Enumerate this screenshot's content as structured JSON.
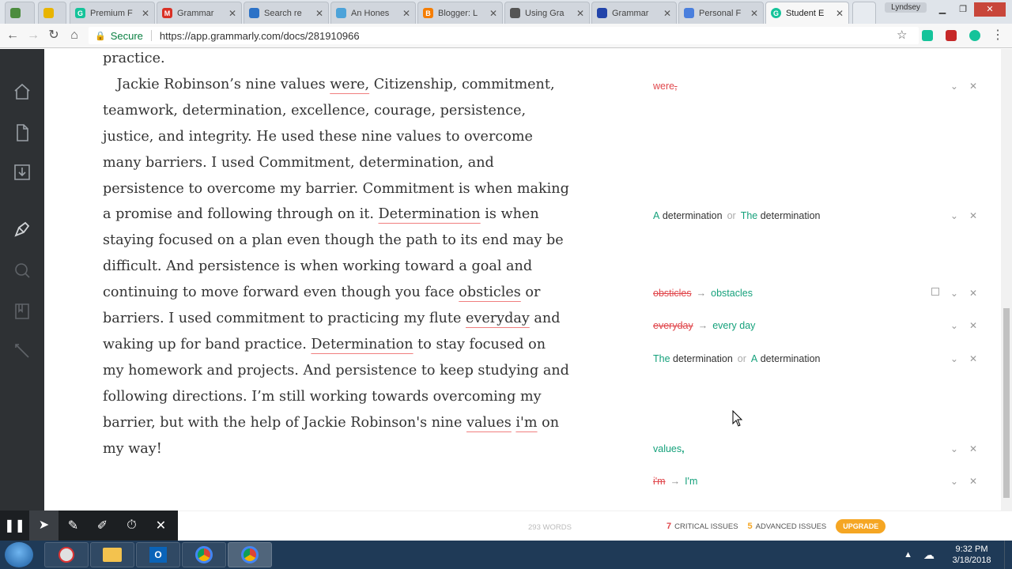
{
  "browser": {
    "tabs": [
      {
        "title": "",
        "color": "#4c8c3e"
      },
      {
        "title": "",
        "color": "#e8b400"
      },
      {
        "title": "Premium F",
        "color": "#15c39a"
      },
      {
        "title": "Grammar",
        "color": "#d93025"
      },
      {
        "title": "Search re",
        "color": "#2c72c7"
      },
      {
        "title": "An Hones",
        "color": "#4da3d9"
      },
      {
        "title": "Blogger: L",
        "color": "#f57d00"
      },
      {
        "title": "Using Gra",
        "color": "#555555"
      },
      {
        "title": "Grammar",
        "color": "#2244aa"
      },
      {
        "title": "Personal F",
        "color": "#4a7fdd"
      },
      {
        "title": "Student E",
        "color": "#15c39a"
      }
    ],
    "profile_name": "Lyndsey",
    "secure_label": "Secure",
    "url": "https://app.grammarly.com/docs/281910966"
  },
  "document": {
    "paragraph_lines": [
      "practice."
    ],
    "p2_parts": {
      "a": " Jackie Robinson’s nine values ",
      "were": "were,",
      "b": " Citizenship, commitment, teamwork, determination, excellence, courage, persistence, justice, and integrity. He used these nine values to overcome many barriers. I used Commitment, determination, and persistence to overcome my barrier. Commitment is when making a promise and following through on it. ",
      "det1": "Determination",
      "c": " is when staying focused on a plan even though the path to its end may be difficult. And persistence is when working toward a goal and continuing to move forward even though you face ",
      "obst": "obsticles",
      "d": " or barriers. I used commitment to practicing my flute ",
      "every": "everyday",
      "e": " and waking up for band practice. ",
      "det2": "Determination",
      "f": " to stay focused on my homework and projects. And persistence to keep studying and following directions. I’m still working towards overcoming my barrier, but with the help of Jackie Robinson's nine ",
      "values": "values",
      "g": " ",
      "im": "i'm",
      "h": " on my way!"
    }
  },
  "suggestions": [
    {
      "type": "remove",
      "old": "were",
      "mark": ","
    },
    {
      "type": "choice",
      "opt1_prefix": "A",
      "opt1_word": "determination",
      "or": "or",
      "opt2_prefix": "The",
      "opt2_word": "determination"
    },
    {
      "type": "replace",
      "old": "obsticles",
      "new": "obstacles"
    },
    {
      "type": "replace",
      "old": "everyday",
      "new": "every day"
    },
    {
      "type": "choice",
      "opt1_prefix": "The",
      "opt1_word": "determination",
      "or": "or",
      "opt2_prefix": "A",
      "opt2_word": "determination"
    },
    {
      "type": "add",
      "word": "values",
      "mark": ","
    },
    {
      "type": "replace",
      "old": "i'm",
      "new": "I'm"
    }
  ],
  "footer": {
    "word_count": "293 WORDS",
    "critical_count": "7",
    "critical_label": "CRITICAL ISSUES",
    "advanced_count": "5",
    "advanced_label": "ADVANCED ISSUES",
    "upgrade_label": "UPGRADE"
  },
  "taskbar": {
    "time": "9:32 PM",
    "date": "3/18/2018"
  }
}
